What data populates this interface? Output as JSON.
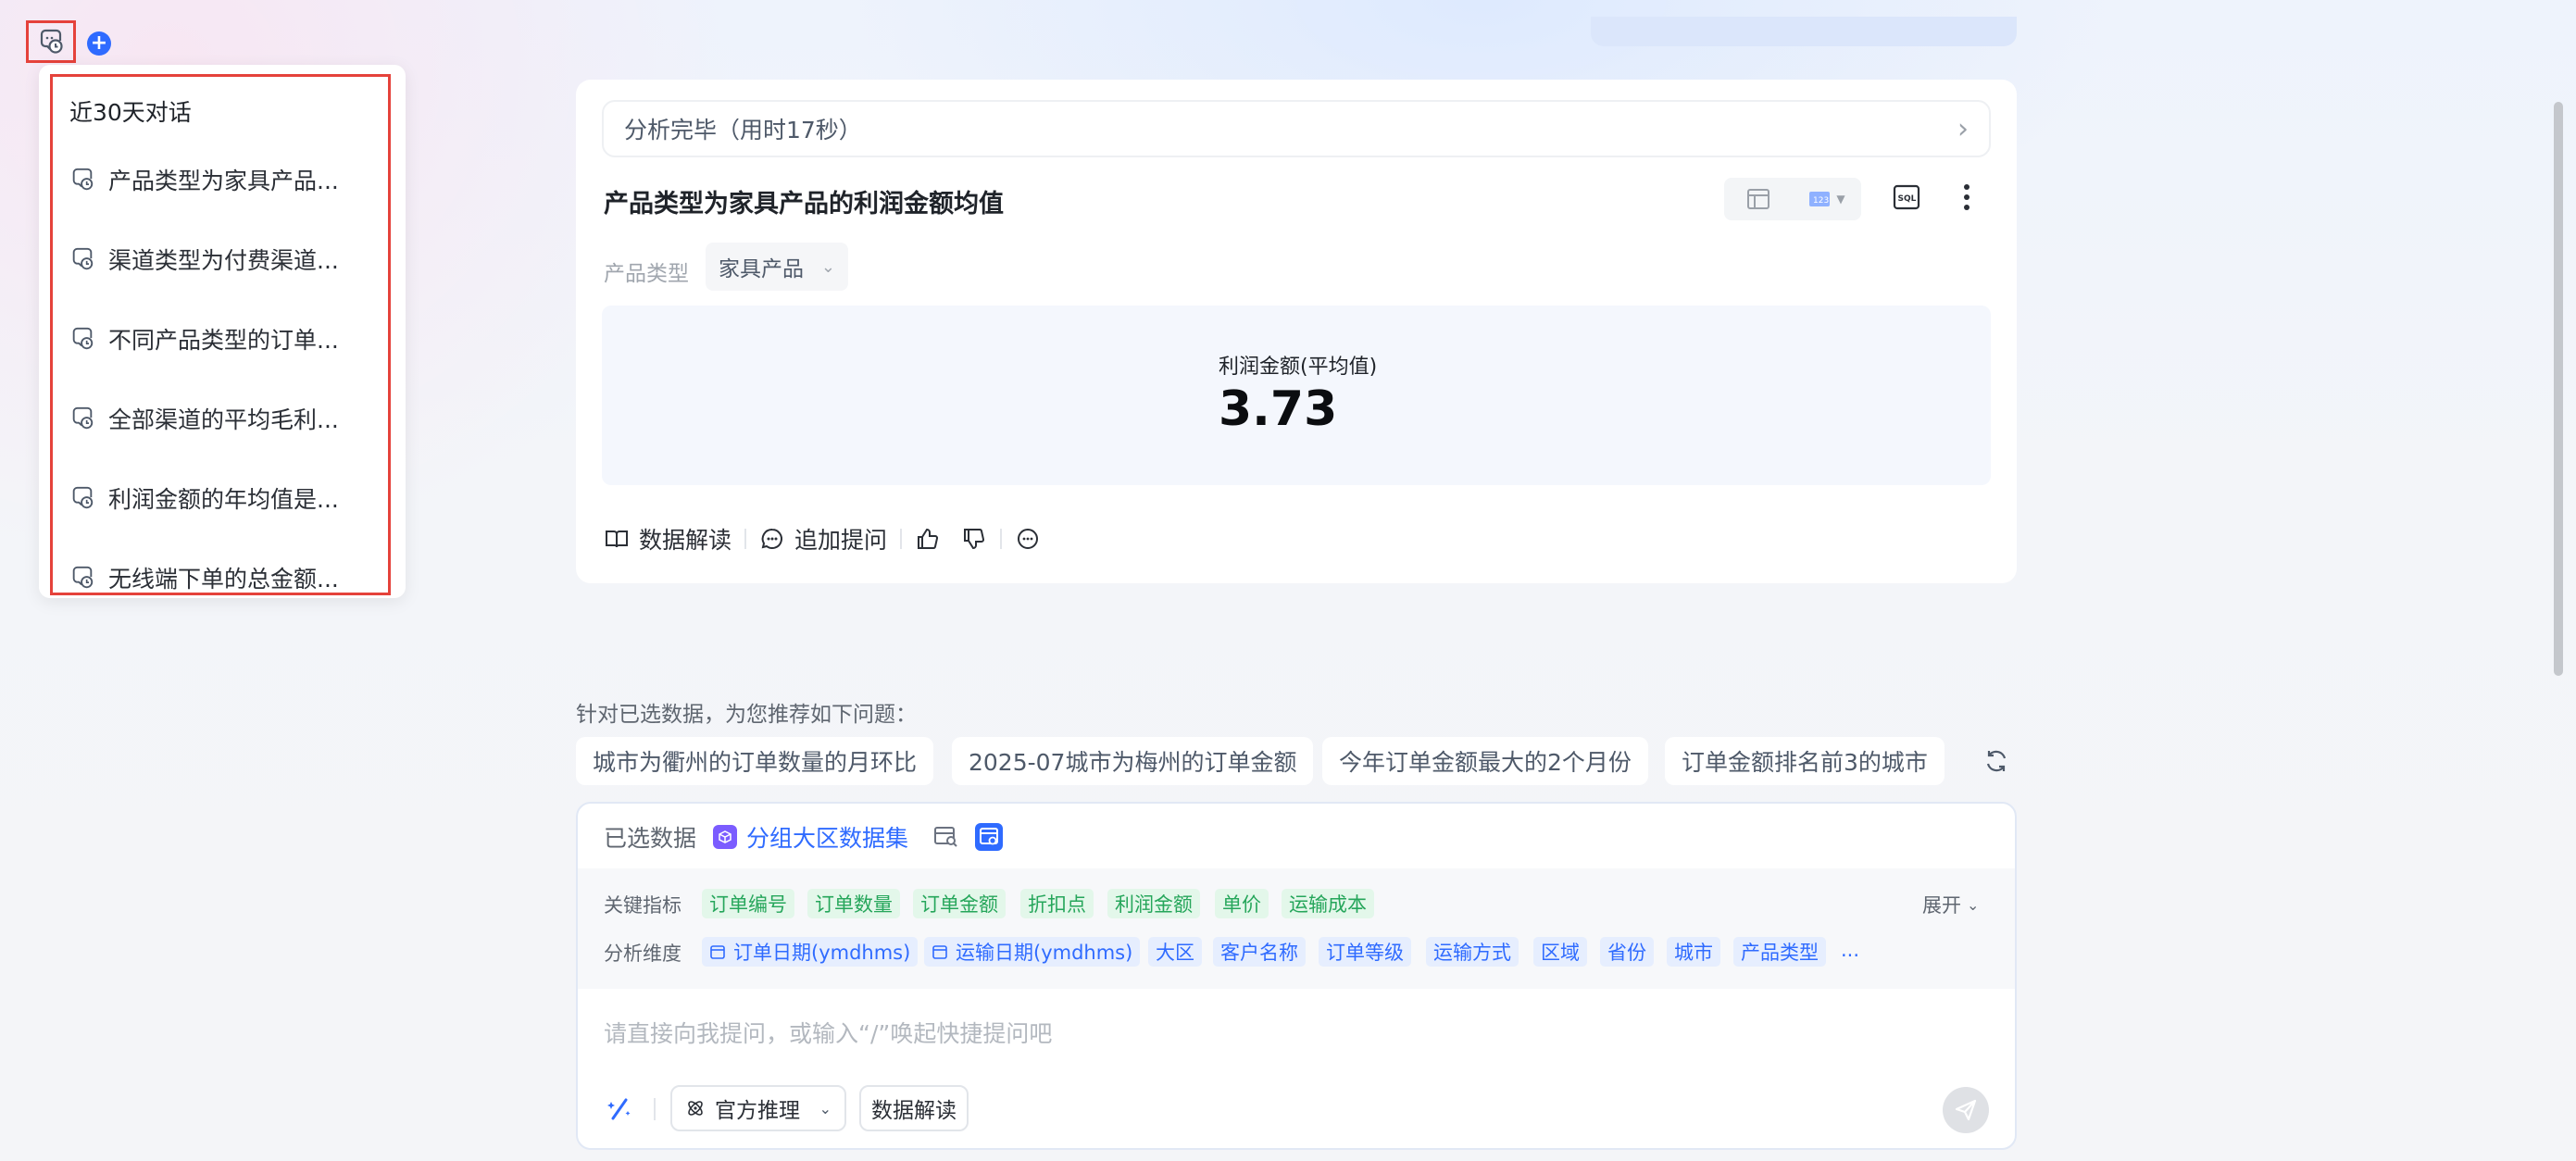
{
  "history": {
    "title": "近30天对话",
    "items": [
      {
        "label": "产品类型为家具产品..."
      },
      {
        "label": "渠道类型为付费渠道..."
      },
      {
        "label": "不同产品类型的订单..."
      },
      {
        "label": "全部渠道的平均毛利..."
      },
      {
        "label": "利润金额的年均值是..."
      },
      {
        "label": "无线端下单的总金额..."
      }
    ]
  },
  "new_chat": {
    "label": "+"
  },
  "result": {
    "status": "分析完毕（用时17秒）",
    "title": "产品类型为家具产品的利润金额均值",
    "sql_label": "SQL",
    "filter": {
      "label": "产品类型",
      "value": "家具产品"
    },
    "metric": {
      "label": "利润金额(平均值)",
      "value": "3.73"
    },
    "actions": {
      "interpret": "数据解读",
      "followup": "追加提问"
    }
  },
  "suggestions": {
    "heading": "针对已选数据，为您推荐如下问题：",
    "items": [
      "城市为衢州的订单数量的月环比",
      "2025-07城市为梅州的订单金额",
      "今年订单金额最大的2个月份",
      "订单金额排名前3的城市"
    ]
  },
  "dataset": {
    "label": "已选数据",
    "name": "分组大区数据集"
  },
  "fields": {
    "metrics_label": "关键指标",
    "metrics": [
      "订单编号",
      "订单数量",
      "订单金额",
      "折扣点",
      "利润金额",
      "单价",
      "运输成本"
    ],
    "dims_label": "分析维度",
    "dims": [
      "订单日期(ymdhms)",
      "运输日期(ymdhms)",
      "大区",
      "客户名称",
      "订单等级",
      "运输方式",
      "区域",
      "省份",
      "城市",
      "产品类型"
    ],
    "more": "...",
    "expand": "展开"
  },
  "composer": {
    "placeholder": "请直接向我提问，或输入“/”唤起快捷提问吧",
    "mode": "官方推理",
    "interpret": "数据解读"
  },
  "colors": {
    "accent": "#2f6bff",
    "highlight": "#e5423b",
    "metric_tag": "#26a65b"
  }
}
